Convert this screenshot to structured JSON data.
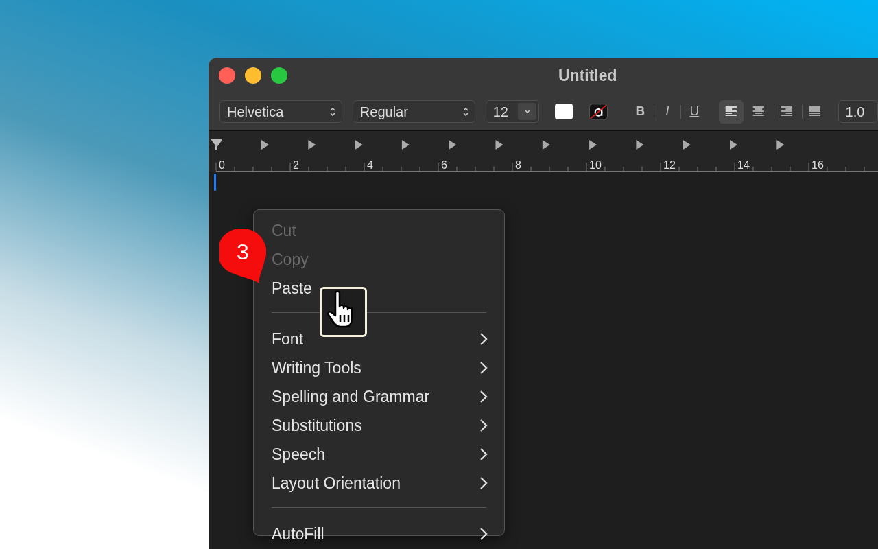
{
  "window": {
    "title": "Untitled"
  },
  "toolbar": {
    "font_family": "Helvetica",
    "font_style": "Regular",
    "font_size": "12",
    "text_styles": [
      "B",
      "I",
      "U"
    ],
    "alignments": [
      {
        "kind": "left",
        "selected": true
      },
      {
        "kind": "center",
        "selected": false
      },
      {
        "kind": "right",
        "selected": false
      },
      {
        "kind": "justify",
        "selected": false
      }
    ],
    "line_spacing": "1.0"
  },
  "ruler": {
    "labels": [
      "0",
      "2",
      "4",
      "6",
      "8",
      "10",
      "12",
      "14",
      "16"
    ]
  },
  "context_menu": {
    "items": [
      {
        "kind": "item",
        "label": "Cut",
        "disabled": true,
        "submenu": false
      },
      {
        "kind": "item",
        "label": "Copy",
        "disabled": true,
        "submenu": false
      },
      {
        "kind": "item",
        "label": "Paste",
        "disabled": false,
        "submenu": false
      },
      {
        "kind": "separator"
      },
      {
        "kind": "item",
        "label": "Font",
        "disabled": false,
        "submenu": true
      },
      {
        "kind": "item",
        "label": "Writing Tools",
        "disabled": false,
        "submenu": true
      },
      {
        "kind": "item",
        "label": "Spelling and Grammar",
        "disabled": false,
        "submenu": true
      },
      {
        "kind": "item",
        "label": "Substitutions",
        "disabled": false,
        "submenu": true
      },
      {
        "kind": "item",
        "label": "Speech",
        "disabled": false,
        "submenu": true
      },
      {
        "kind": "item",
        "label": "Layout Orientation",
        "disabled": false,
        "submenu": true
      },
      {
        "kind": "separator"
      },
      {
        "kind": "item",
        "label": "AutoFill",
        "disabled": false,
        "submenu": true
      }
    ]
  },
  "step_badge": "3"
}
